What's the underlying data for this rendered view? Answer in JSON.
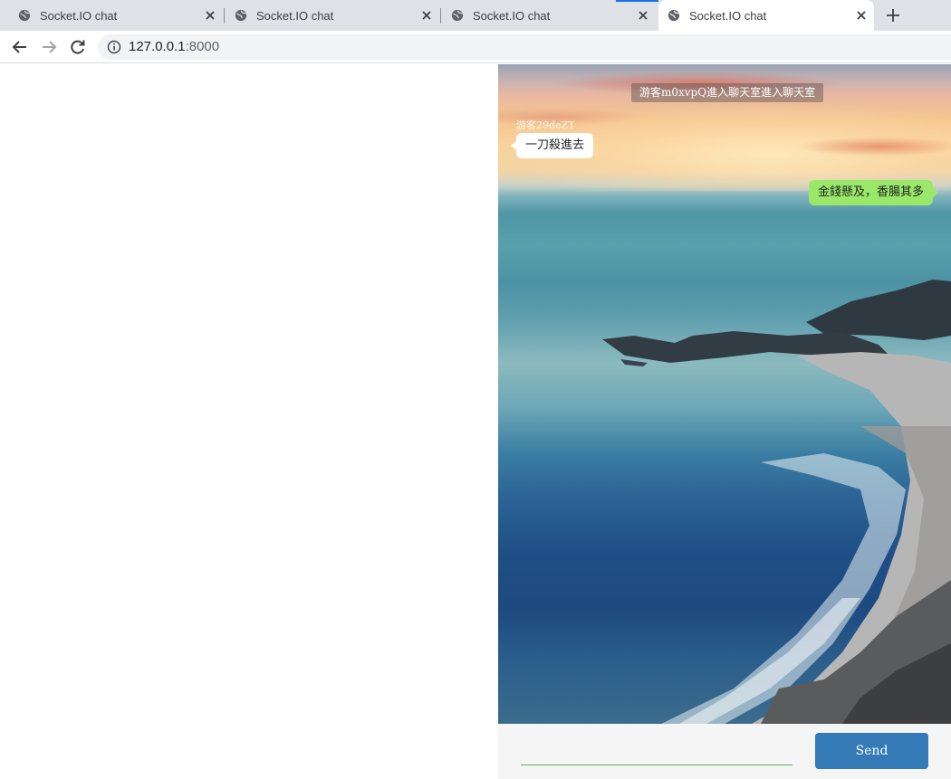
{
  "browser": {
    "tabs": [
      {
        "title": "Socket.IO chat",
        "active": false
      },
      {
        "title": "Socket.IO chat",
        "active": false
      },
      {
        "title": "Socket.IO chat",
        "active": false
      },
      {
        "title": "Socket.IO chat",
        "active": true
      }
    ],
    "url_host": "127.0.0.1",
    "url_port": ":8000"
  },
  "chat": {
    "system_notice": "游客m0xvpQ進入聊天室進入聊天室",
    "messages": [
      {
        "sender": "游客29deZT",
        "text": "一刀殺進去",
        "side": "left"
      },
      {
        "sender": "",
        "text": "金錢懸及，香腸其多",
        "side": "right"
      }
    ],
    "input_value": "",
    "send_label": "Send"
  },
  "colors": {
    "active_tab_indicator": "#1a73e8",
    "own_bubble": "#9ae86a",
    "other_bubble": "#ffffff",
    "send_button": "#337ab7",
    "input_underline": "#5cb85c"
  }
}
